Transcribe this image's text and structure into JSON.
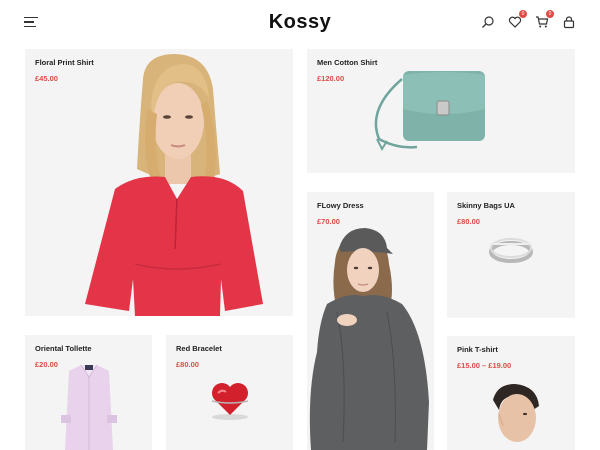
{
  "header": {
    "logo": "Kossy",
    "wishlist_count": "0",
    "cart_count": "0"
  },
  "products": [
    {
      "name": "Floral Print Shirt",
      "price": "£45.00"
    },
    {
      "name": "Men Cotton Shirt",
      "price": "£120.00"
    },
    {
      "name": "FLowy Dress",
      "price": "£70.00"
    },
    {
      "name": "Skinny Bags UA",
      "price": "£80.00"
    },
    {
      "name": "Oriental Tollette",
      "price": "£20.00"
    },
    {
      "name": "Red Bracelet",
      "price": "£80.00"
    },
    {
      "name": "Pink T-shirt",
      "price": "£15.00 – £19.00"
    }
  ],
  "colors": {
    "accent": "#e04a45",
    "card_bg": "#f4f4f4"
  }
}
